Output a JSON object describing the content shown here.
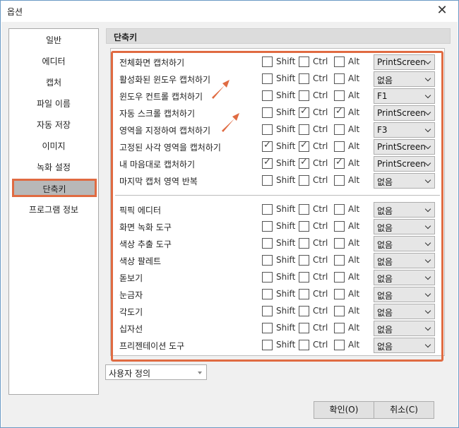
{
  "window": {
    "title": "옵션",
    "close_glyph": "✕"
  },
  "sidebar": {
    "items": [
      {
        "label": "일반"
      },
      {
        "label": "에디터"
      },
      {
        "label": "캡처"
      },
      {
        "label": "파일 이름"
      },
      {
        "label": "자동 저장"
      },
      {
        "label": "이미지"
      },
      {
        "label": "녹화 설정"
      },
      {
        "label": "단축키",
        "selected": true
      },
      {
        "label": "프로그램 정보"
      }
    ]
  },
  "panel": {
    "title": "단축키",
    "modifier_labels": {
      "shift": "Shift",
      "ctrl": "Ctrl",
      "alt": "Alt"
    },
    "group1": [
      {
        "label": "전체화면 캡처하기",
        "shift": false,
        "ctrl": false,
        "alt": false,
        "key": "PrintScreen"
      },
      {
        "label": "활성화된 윈도우 캡처하기",
        "shift": false,
        "ctrl": false,
        "alt": false,
        "key": "없음"
      },
      {
        "label": "윈도우 컨트롤 캡처하기",
        "shift": false,
        "ctrl": false,
        "alt": false,
        "key": "F1"
      },
      {
        "label": "자동 스크롤 캡처하기",
        "shift": false,
        "ctrl": true,
        "alt": true,
        "key": "PrintScreen"
      },
      {
        "label": "영역을 지정하여 캡처하기",
        "shift": false,
        "ctrl": false,
        "alt": false,
        "key": "F3"
      },
      {
        "label": "고정된 사각 영역을 캡처하기",
        "shift": true,
        "ctrl": true,
        "alt": false,
        "key": "PrintScreen"
      },
      {
        "label": "내 마음대로 캡처하기",
        "shift": true,
        "ctrl": true,
        "alt": true,
        "key": "PrintScreen"
      },
      {
        "label": "마지막 캡처 영역 반복",
        "shift": false,
        "ctrl": false,
        "alt": false,
        "key": "없음"
      }
    ],
    "group2": [
      {
        "label": "픽픽 에디터",
        "shift": false,
        "ctrl": false,
        "alt": false,
        "key": "없음"
      },
      {
        "label": "화면 녹화 도구",
        "shift": false,
        "ctrl": false,
        "alt": false,
        "key": "없음"
      },
      {
        "label": "색상 추출 도구",
        "shift": false,
        "ctrl": false,
        "alt": false,
        "key": "없음"
      },
      {
        "label": "색상 팔레트",
        "shift": false,
        "ctrl": false,
        "alt": false,
        "key": "없음"
      },
      {
        "label": "돋보기",
        "shift": false,
        "ctrl": false,
        "alt": false,
        "key": "없음"
      },
      {
        "label": "눈금자",
        "shift": false,
        "ctrl": false,
        "alt": false,
        "key": "없음"
      },
      {
        "label": "각도기",
        "shift": false,
        "ctrl": false,
        "alt": false,
        "key": "없음"
      },
      {
        "label": "십자선",
        "shift": false,
        "ctrl": false,
        "alt": false,
        "key": "없음"
      },
      {
        "label": "프리젠테이션 도구",
        "shift": false,
        "ctrl": false,
        "alt": false,
        "key": "없음"
      }
    ]
  },
  "preset": {
    "value": "사용자 정의"
  },
  "buttons": {
    "ok": "확인(O)",
    "cancel": "취소(C)"
  },
  "colors": {
    "accent": "#e06b42",
    "selected_bg": "#b8b8b8"
  },
  "icons": {
    "check": "check-icon",
    "dropdown": "chevron-down-icon",
    "annotation": "arrow-annotation-icon"
  }
}
